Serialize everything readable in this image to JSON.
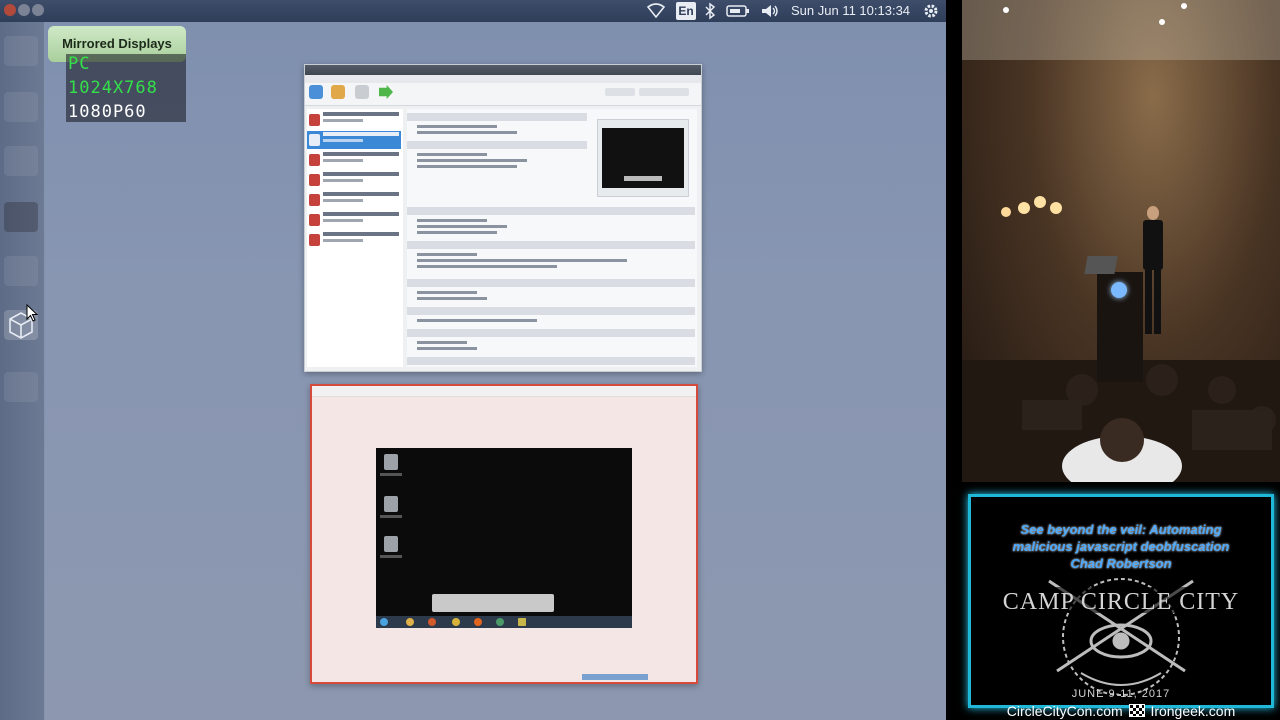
{
  "topbar": {
    "input_indicator": "En",
    "datetime": "Sun Jun 11 10:13:34"
  },
  "osd": {
    "title": "Mirrored Displays",
    "source": "PC",
    "input_resolution": "1024X768",
    "output_mode": "1080P60"
  },
  "talk": {
    "title_line1": "See beyond the veil: Automating",
    "title_line2": "malicious javascript deobfuscation",
    "speaker": "Chad Robertson",
    "logo_text": "CAMP CIRCLE CITY",
    "logo_date": "JUNE 9-11, 2017"
  },
  "footer": {
    "site1": "CircleCityCon.com",
    "site2": "Irongeek.com"
  },
  "colors": {
    "osd_source": "#33e04a",
    "osd_text": "#ffffff",
    "title_card_border": "#1fb8d9",
    "guest_frame_border": "#d54a3a"
  },
  "icons": {
    "wifi": "wifi-icon",
    "bluetooth": "bluetooth-icon",
    "battery": "battery-icon",
    "volume": "volume-icon",
    "settings": "gear-icon"
  }
}
